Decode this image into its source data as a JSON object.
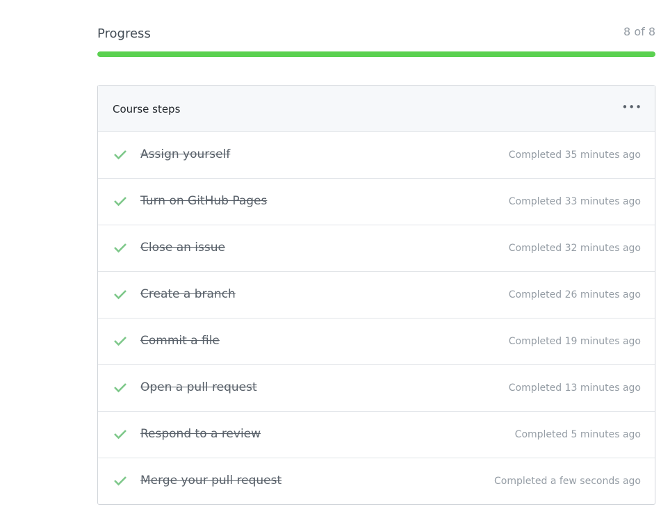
{
  "progress": {
    "title": "Progress",
    "count_label": "8 of 8",
    "completed": 8,
    "total": 8,
    "percent": 100,
    "bar_color": "#5bd150"
  },
  "course": {
    "title": "Course steps",
    "more_label": "•••",
    "check_color": "#7ec88a",
    "steps": [
      {
        "name": "Assign yourself",
        "status": "Completed 35 minutes ago"
      },
      {
        "name": "Turn on GitHub Pages",
        "status": "Completed 33 minutes ago"
      },
      {
        "name": "Close an issue",
        "status": "Completed 32 minutes ago"
      },
      {
        "name": "Create a branch",
        "status": "Completed 26 minutes ago"
      },
      {
        "name": "Commit a file",
        "status": "Completed 19 minutes ago"
      },
      {
        "name": "Open a pull request",
        "status": "Completed 13 minutes ago"
      },
      {
        "name": "Respond to a review",
        "status": "Completed 5 minutes ago"
      },
      {
        "name": "Merge your pull request",
        "status": "Completed a few seconds ago"
      }
    ]
  }
}
